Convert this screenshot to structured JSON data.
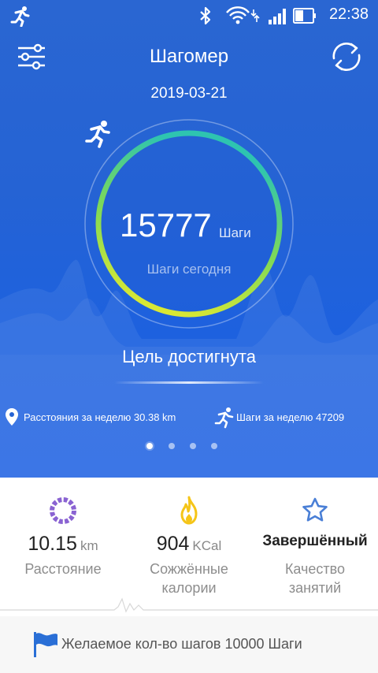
{
  "status_bar": {
    "time": "22:38",
    "icons": [
      "runner-icon",
      "bluetooth-icon",
      "wifi-icon",
      "signal-icon",
      "battery-icon"
    ]
  },
  "app_bar": {
    "title": "Шагомер",
    "left_icon": "settings-sliders-icon",
    "right_icon": "sync-icon"
  },
  "date": "2019-03-21",
  "ring": {
    "steps": "15777",
    "unit": "Шаги",
    "caption": "Шаги сегодня",
    "progress": 1.0,
    "colors": {
      "start": "#f2ec2a",
      "mid": "#7ed957",
      "end": "#2ec4b0"
    }
  },
  "goal_status": "Цель достигнута",
  "week": {
    "distance_label": "Расстояния за неделю 30.38 km",
    "steps_label": "Шаги за неделю 47209"
  },
  "pager": {
    "count": 4,
    "active": 0
  },
  "stats": [
    {
      "icon": "distance-ring-icon",
      "value": "10.15",
      "unit": "km",
      "label_lines": [
        "Расстояние"
      ],
      "icon_color": "#8a63d2"
    },
    {
      "icon": "flame-icon",
      "value": "904",
      "unit": "KCal",
      "label_lines": [
        "Сожжённые",
        "калории"
      ],
      "icon_color": "#f5c518"
    },
    {
      "icon": "star-icon",
      "value": "Завершённый",
      "unit": "",
      "label_lines": [
        "Качество",
        "занятий"
      ],
      "icon_color": "#4a7fd6"
    }
  ],
  "goal_bar": {
    "icon": "flag-icon",
    "text": "Желаемое кол-во шагов 10000 Шаги"
  },
  "colors": {
    "hero_blue": "#2563d4",
    "accent_blue": "#2a6fd6"
  }
}
